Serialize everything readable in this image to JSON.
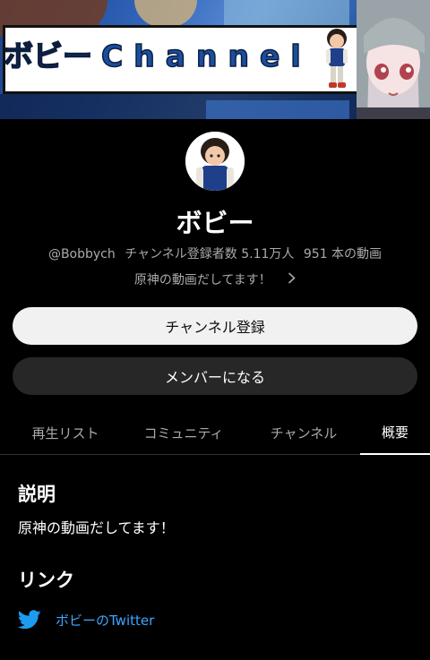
{
  "banner": {
    "title_lead": "ボビー",
    "title_rest": "Channel"
  },
  "channel": {
    "name": "ボビー",
    "handle": "@Bobbych",
    "subscribers": "チャンネル登録者数 5.11万人",
    "videos": "951 本の動画",
    "short_description": "原神の動画だしてます！"
  },
  "buttons": {
    "subscribe": "チャンネル登録",
    "join": "メンバーになる"
  },
  "tabs": [
    {
      "label": "再生リスト"
    },
    {
      "label": "コミュニティ"
    },
    {
      "label": "チャンネル"
    },
    {
      "label": "概要",
      "active": true
    }
  ],
  "about": {
    "description_heading": "説明",
    "description_text": "原神の動画だしてます！",
    "links_heading": "リンク",
    "links": [
      {
        "label": "ボビーのTwitter",
        "icon": "twitter-icon"
      }
    ]
  },
  "colors": {
    "background": "#000000",
    "link": "#3ea6ff",
    "secondary_text": "#aaaaaa",
    "twitter": "#1d9bf0"
  }
}
